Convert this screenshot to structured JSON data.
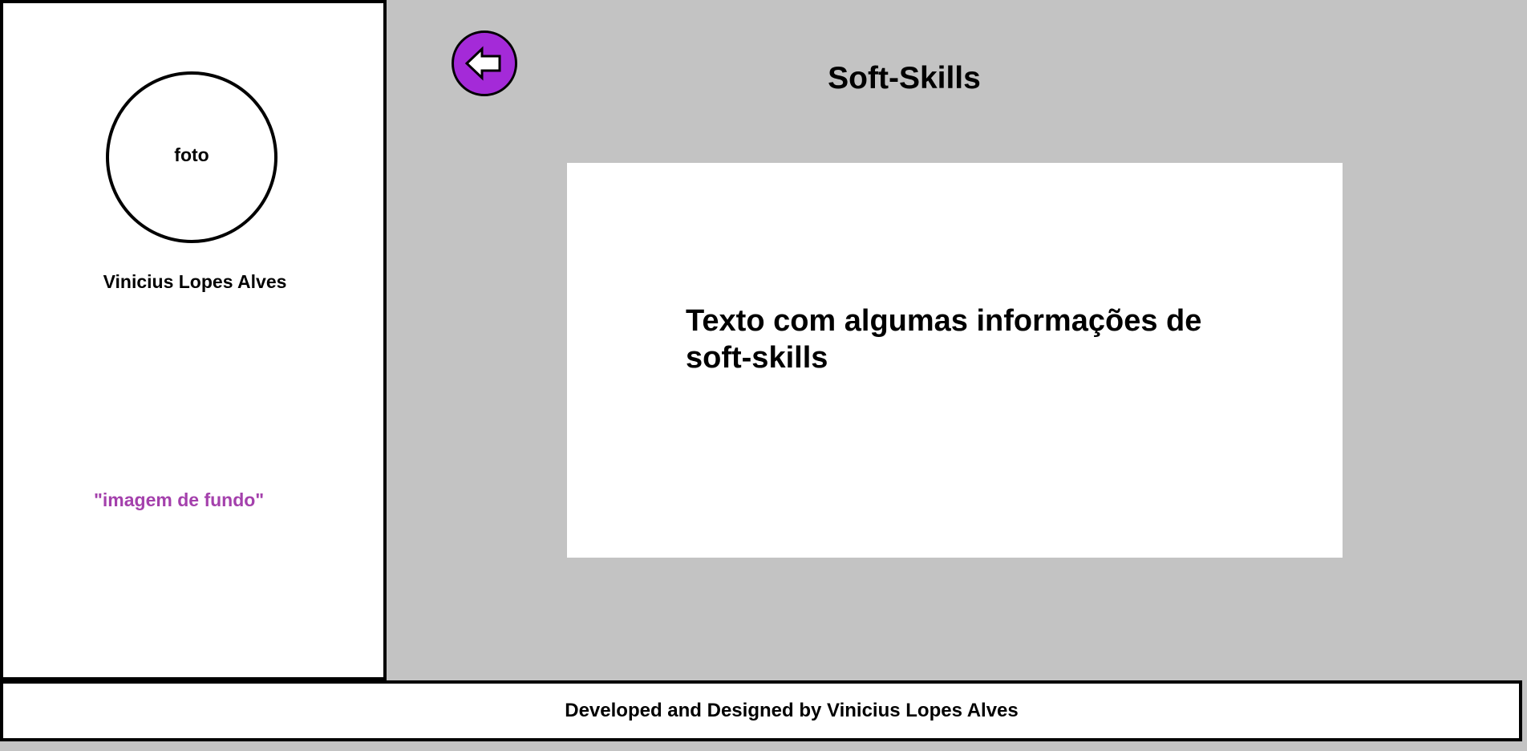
{
  "sidebar": {
    "photo_label": "foto",
    "name": "Vinicius Lopes Alves",
    "background_note": "\"imagem de fundo\""
  },
  "header": {
    "back_icon": "back-arrow-icon",
    "title": "Soft-Skills"
  },
  "main": {
    "content_text": "Texto com algumas informações de soft-skills"
  },
  "footer": {
    "credit": "Developed and Designed by Vinicius Lopes Alves"
  },
  "colors": {
    "background": "#c3c3c3",
    "panel": "#ffffff",
    "accent": "#a42ad8",
    "note_text": "#a440ac"
  }
}
